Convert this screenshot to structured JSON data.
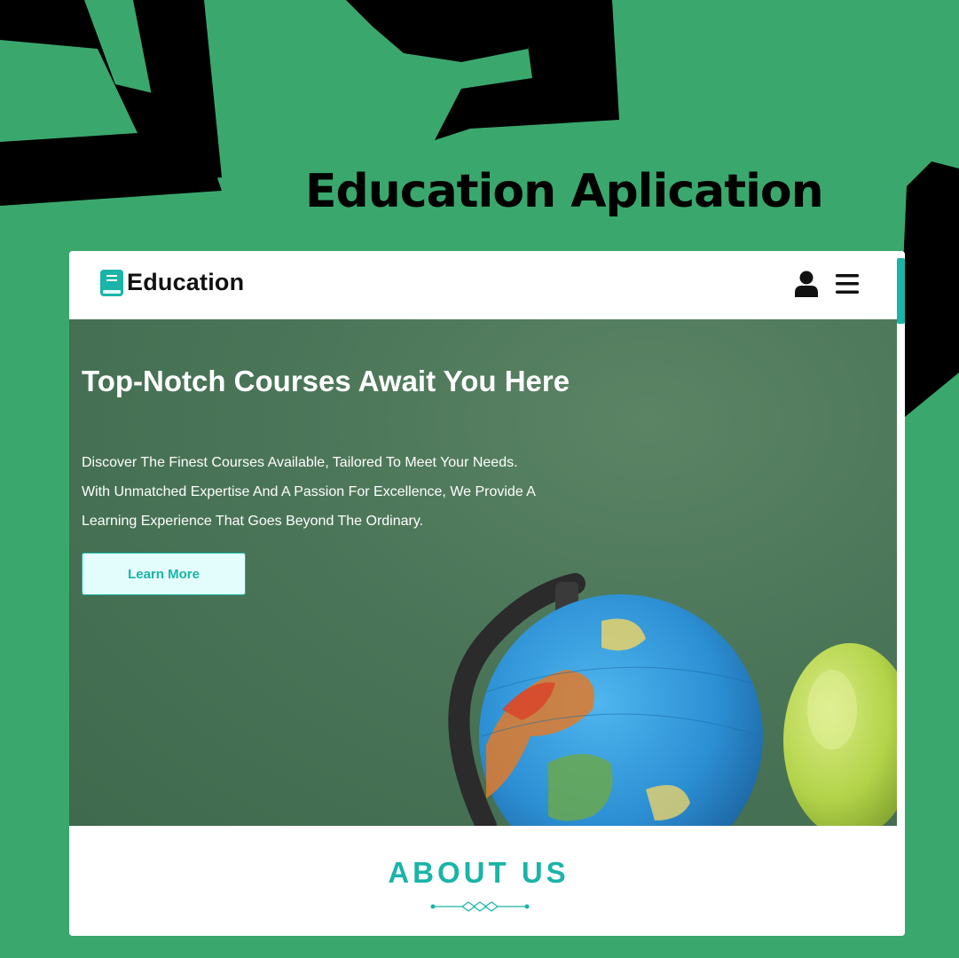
{
  "promo": {
    "title": "Education Aplication"
  },
  "navbar": {
    "brand": "Education",
    "icons": [
      "book-icon",
      "user-icon",
      "menu-icon"
    ]
  },
  "hero": {
    "title": "Top-Notch Courses Await You Here",
    "lines": [
      "Discover The Finest Courses Available, Tailored To Meet Your Needs.",
      "With Unmatched Expertise And A Passion For Excellence, We Provide A",
      "Learning Experience That Goes Beyond The Ordinary."
    ],
    "button_label": "Learn More"
  },
  "about": {
    "title": "ABOUT US"
  },
  "colors": {
    "background": "#3aa86d",
    "accent": "#1ab4a8",
    "button_bg": "#e3fdfc",
    "hero_bg": "#4b7558",
    "text_dark": "#111111"
  }
}
